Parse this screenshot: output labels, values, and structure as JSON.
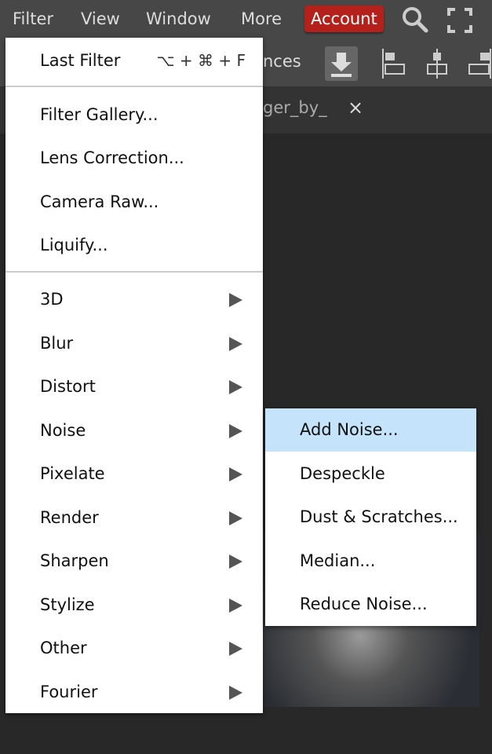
{
  "menubar": {
    "items": [
      "Filter",
      "View",
      "Window",
      "More"
    ],
    "account": "Account"
  },
  "toolbar": {
    "partial_label": "nces"
  },
  "tab": {
    "partial_title": "ger_by_",
    "close": "×"
  },
  "filter_menu": {
    "last_filter": {
      "label": "Last Filter",
      "shortcut": "⌥ + ⌘ + F"
    },
    "dialogs": [
      "Filter Gallery...",
      "Lens Correction...",
      "Camera Raw...",
      "Liquify..."
    ],
    "submenus": [
      "3D",
      "Blur",
      "Distort",
      "Noise",
      "Pixelate",
      "Render",
      "Sharpen",
      "Stylize",
      "Other",
      "Fourier"
    ]
  },
  "noise_submenu": {
    "items": [
      "Add Noise...",
      "Despeckle",
      "Dust & Scratches...",
      "Median...",
      "Reduce Noise..."
    ],
    "highlighted": "Add Noise..."
  },
  "colors": {
    "accent": "#b5211a",
    "highlight": "#c5e3fa"
  }
}
